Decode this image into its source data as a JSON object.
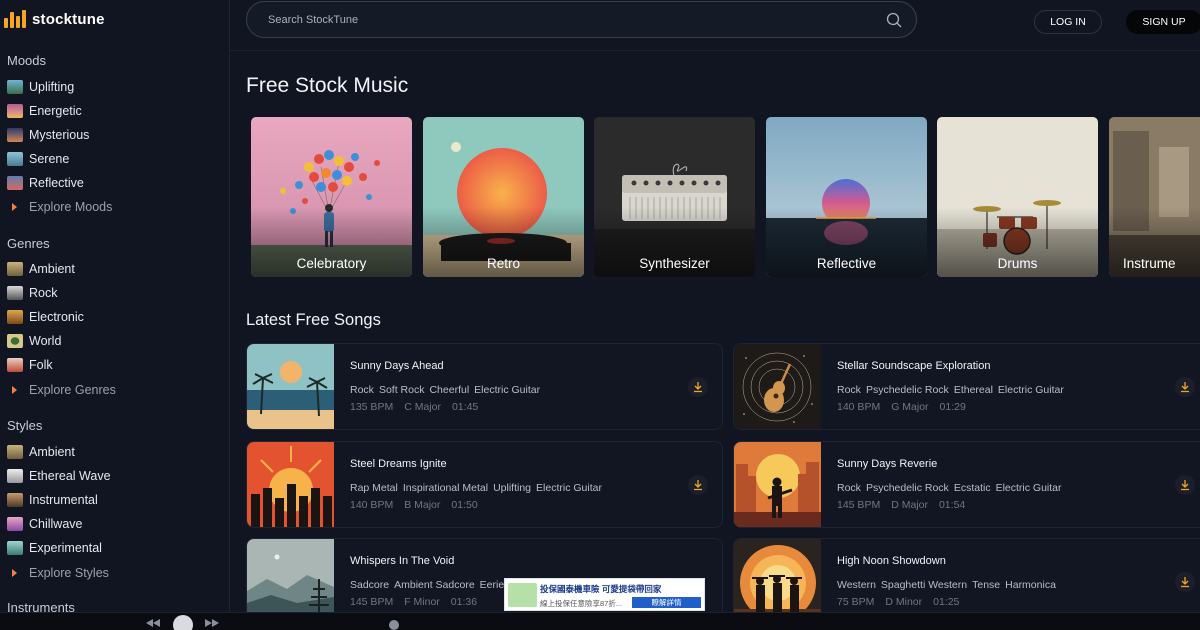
{
  "brand": {
    "name": "stocktune",
    "accent": "#f5a623"
  },
  "search": {
    "placeholder": "Search StockTune",
    "icon": "search-icon"
  },
  "auth": {
    "login_label": "LOG IN",
    "signup_label": "SIGN UP"
  },
  "sidebar": {
    "moods": {
      "title": "Moods",
      "items": [
        "Uplifting",
        "Energetic",
        "Mysterious",
        "Serene",
        "Reflective"
      ],
      "explore": "Explore Moods"
    },
    "genres": {
      "title": "Genres",
      "items": [
        "Ambient",
        "Rock",
        "Electronic",
        "World",
        "Folk"
      ],
      "explore": "Explore Genres"
    },
    "styles": {
      "title": "Styles",
      "items": [
        "Ambient",
        "Ethereal Wave",
        "Instrumental",
        "Chillwave",
        "Experimental"
      ],
      "explore": "Explore Styles"
    },
    "instruments": {
      "title": "Instruments"
    }
  },
  "main": {
    "heading": "Free Stock Music",
    "categories": [
      "Celebratory",
      "Retro",
      "Synthesizer",
      "Reflective",
      "Drums",
      "Instrume"
    ],
    "latest_heading": "Latest Free Songs",
    "songs": [
      {
        "title": "Sunny Days Ahead",
        "tags": [
          "Rock",
          "Soft Rock",
          "Cheerful",
          "Electric Guitar"
        ],
        "bpm": "135 BPM",
        "key": "C Major",
        "duration": "01:45"
      },
      {
        "title": "Stellar Soundscape Exploration",
        "tags": [
          "Rock",
          "Psychedelic Rock",
          "Ethereal",
          "Electric Guitar"
        ],
        "bpm": "140 BPM",
        "key": "G Major",
        "duration": "01:29"
      },
      {
        "title": "Steel Dreams Ignite",
        "tags": [
          "Rap Metal",
          "Inspirational Metal",
          "Uplifting",
          "Electric Guitar"
        ],
        "bpm": "140 BPM",
        "key": "B Major",
        "duration": "01:50"
      },
      {
        "title": "Sunny Days Reverie",
        "tags": [
          "Rock",
          "Psychedelic Rock",
          "Ecstatic",
          "Electric Guitar"
        ],
        "bpm": "145 BPM",
        "key": "D Major",
        "duration": "01:54"
      },
      {
        "title": "Whispers In The Void",
        "tags": [
          "Sadcore",
          "Ambient Sadcore",
          "Eerie"
        ],
        "bpm": "145 BPM",
        "key": "F Minor",
        "duration": "01:36"
      },
      {
        "title": "High Noon Showdown",
        "tags": [
          "Western",
          "Spaghetti Western",
          "Tense",
          "Harmonica"
        ],
        "bpm": "75 BPM",
        "key": "D Minor",
        "duration": "01:25"
      }
    ]
  },
  "ad": {
    "title": "投保國泰機車險 可愛提袋帶回家",
    "text": "線上投保任意險享87折...",
    "button": "瞭解詳情"
  }
}
